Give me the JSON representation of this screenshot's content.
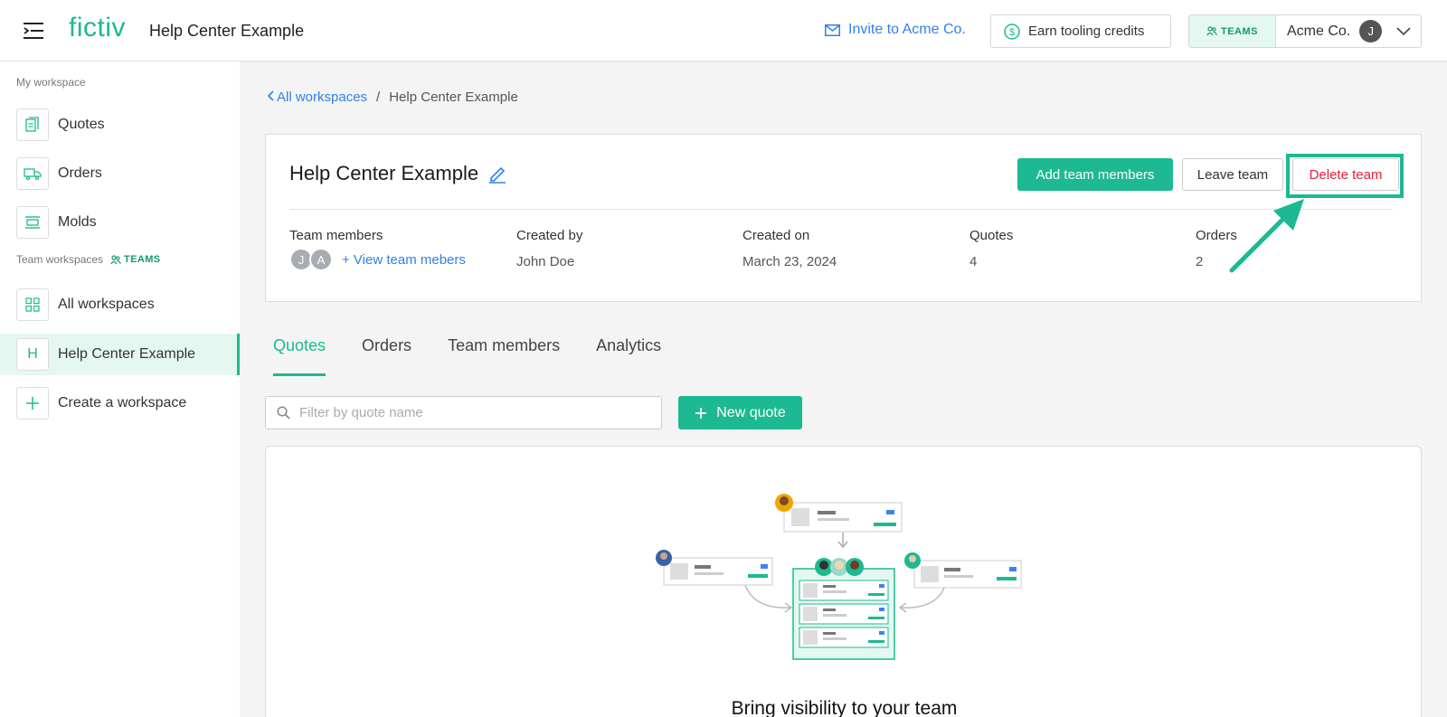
{
  "header": {
    "logo": "fictiv",
    "title": "Help Center Example",
    "invite_label": "Invite to Acme Co.",
    "earn_label": "Earn tooling credits",
    "teams_badge": "TEAMS",
    "org_name": "Acme Co.",
    "user_initial": "J"
  },
  "sidebar": {
    "my_workspace_label": "My workspace",
    "my_items": [
      {
        "label": "Quotes",
        "icon": "quote-doc-icon"
      },
      {
        "label": "Orders",
        "icon": "truck-icon"
      },
      {
        "label": "Molds",
        "icon": "mold-icon"
      }
    ],
    "team_workspaces_label": "Team workspaces",
    "teams_badge": "TEAMS",
    "team_items": [
      {
        "label": "All workspaces",
        "icon": "grid-icon"
      },
      {
        "label": "Help Center Example",
        "icon_letter": "H",
        "active": true
      },
      {
        "label": "Create a workspace",
        "icon": "plus-icon"
      }
    ]
  },
  "breadcrumb": {
    "back_label": "All workspaces",
    "separator": "/",
    "current": "Help Center Example"
  },
  "team": {
    "name": "Help Center Example",
    "add_members_label": "Add team members",
    "leave_label": "Leave team",
    "delete_label": "Delete team",
    "stats": {
      "members_label": "Team members",
      "member_initials": [
        "J",
        "A"
      ],
      "view_members_label": "+ View team mebers",
      "created_by_label": "Created by",
      "created_by_value": "John Doe",
      "created_on_label": "Created on",
      "created_on_value": "March 23, 2024",
      "quotes_label": "Quotes",
      "quotes_value": "4",
      "orders_label": "Orders",
      "orders_value": "2"
    }
  },
  "tabs": [
    "Quotes",
    "Orders",
    "Team members",
    "Analytics"
  ],
  "active_tab": "Quotes",
  "filter": {
    "placeholder": "Filter by quote name"
  },
  "new_quote_label": "New quote",
  "empty_state": {
    "heading": "Bring visibility to your team"
  },
  "colors": {
    "accent": "#1cb992",
    "link": "#2f80ed",
    "danger": "#e3213a"
  }
}
